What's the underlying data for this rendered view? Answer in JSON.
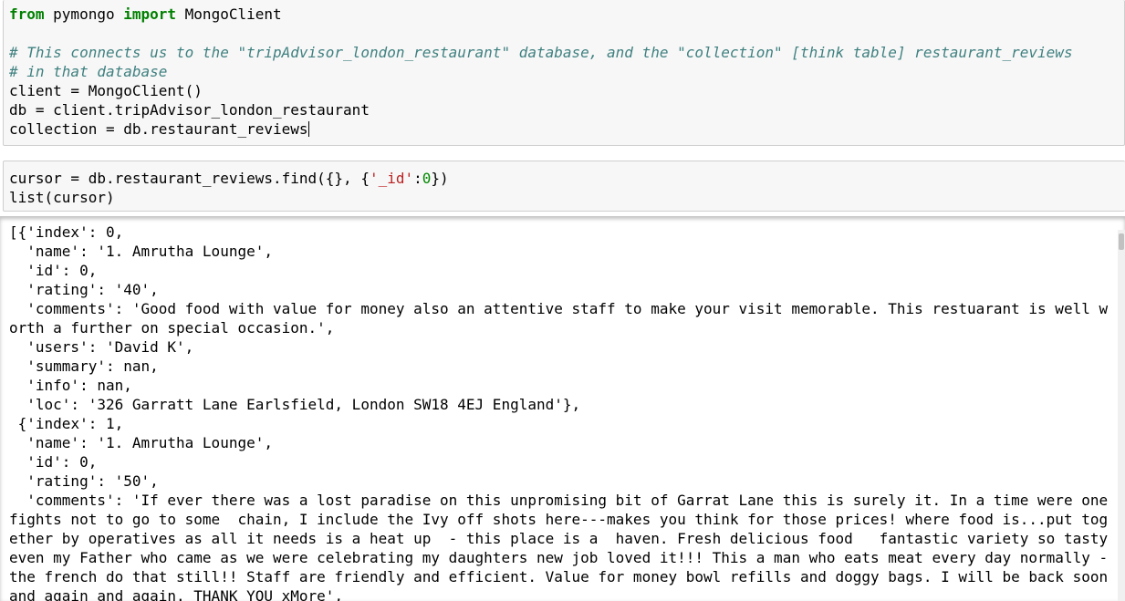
{
  "cells": [
    {
      "lines": [
        {
          "parts": [
            {
              "t": "from",
              "c": "kw"
            },
            {
              "t": " pymongo ",
              "c": ""
            },
            {
              "t": "import",
              "c": "kw"
            },
            {
              "t": " MongoClient",
              "c": ""
            }
          ]
        },
        {
          "parts": []
        },
        {
          "parts": [
            {
              "t": "# This connects us to the \"tripAdvisor_london_restaurant\" database, and the \"collection\" [think table] restaurant_reviews",
              "c": "cm"
            }
          ]
        },
        {
          "parts": [
            {
              "t": "# in that database",
              "c": "cm"
            }
          ]
        },
        {
          "parts": [
            {
              "t": "client = MongoClient()",
              "c": ""
            }
          ]
        },
        {
          "parts": [
            {
              "t": "db = client.tripAdvisor_london_restaurant",
              "c": ""
            }
          ]
        },
        {
          "parts": [
            {
              "t": "collection = db.restaurant_reviews",
              "c": ""
            }
          ],
          "cursor": true
        }
      ]
    },
    {
      "lines": [
        {
          "parts": [
            {
              "t": "cursor = db.restaurant_reviews.find({}, {",
              "c": ""
            },
            {
              "t": "'_id'",
              "c": "st"
            },
            {
              "t": ":",
              "c": ""
            },
            {
              "t": "0",
              "c": "nm"
            },
            {
              "t": "})",
              "c": ""
            }
          ]
        },
        {
          "parts": [
            {
              "t": "list(cursor)",
              "c": ""
            }
          ]
        }
      ]
    }
  ],
  "output": {
    "text": "[{'index': 0,\n  'name': '1. Amrutha Lounge',\n  'id': 0,\n  'rating': '40',\n  'comments': 'Good food with value for money also an attentive staff to make your visit memorable. This restuarant is well worth a further on special occasion.',\n  'users': 'David K',\n  'summary': nan,\n  'info': nan,\n  'loc': '326 Garratt Lane Earlsfield, London SW18 4EJ England'},\n {'index': 1,\n  'name': '1. Amrutha Lounge',\n  'id': 0,\n  'rating': '50',\n  'comments': 'If ever there was a lost paradise on this unpromising bit of Garrat Lane this is surely it. In a time were one fights not to go to some  chain, I include the Ivy off shots here---makes you think for those prices! where food is...put together by operatives as all it needs is a heat up  - this place is a  haven. Fresh delicious food   fantastic variety so tasty even my Father who came as we were celebrating my daughters new job loved it!!! This a man who eats meat every day normally - the french do that still!! Staff are friendly and efficient. Value for money bowl refills and doggy bags. I will be back soon and again and again. THANK YOU xMore',"
  }
}
